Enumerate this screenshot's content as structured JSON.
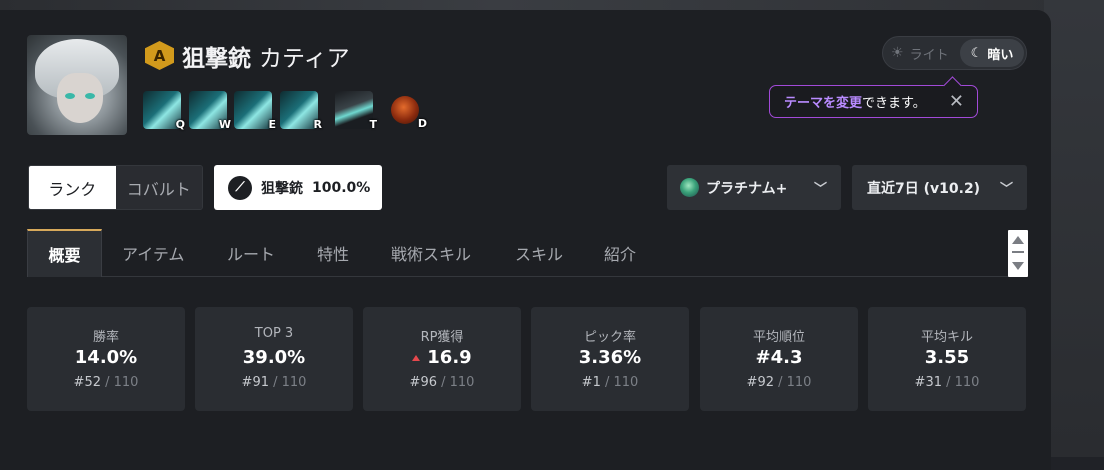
{
  "character": {
    "tier": "A",
    "weapon": "狙撃銃",
    "name": "カティア",
    "skills": [
      {
        "key": "Q",
        "icon": "skill-q-icon"
      },
      {
        "key": "W",
        "icon": "skill-w-icon"
      },
      {
        "key": "E",
        "icon": "skill-e-icon"
      },
      {
        "key": "R",
        "icon": "skill-r-icon"
      },
      {
        "key": "T",
        "icon": "skill-t-icon"
      },
      {
        "key": "D",
        "icon": "skill-d-icon"
      }
    ]
  },
  "theme": {
    "light_label": "ライト",
    "dark_label": "暗い",
    "selected": "dark"
  },
  "tooltip": {
    "highlight": "テーマを変更",
    "rest": "できます。",
    "close": "✕"
  },
  "filters": {
    "mode_options": [
      "ランク",
      "コバルト"
    ],
    "mode_selected": "ランク",
    "weapon_label": "狙撃銃",
    "weapon_pct": "100.0%",
    "tier_label": "プラチナム+",
    "period_label": "直近7日 (v10.2)"
  },
  "tabs": [
    "概要",
    "アイテム",
    "ルート",
    "特性",
    "戦術スキル",
    "スキル",
    "紹介"
  ],
  "stats": [
    {
      "label": "勝率",
      "value": "14.0%",
      "rank": "#52",
      "total": " / 110",
      "trend": ""
    },
    {
      "label": "TOP 3",
      "value": "39.0%",
      "rank": "#91",
      "total": " / 110",
      "trend": ""
    },
    {
      "label": "RP獲得",
      "value": "16.9",
      "rank": "#96",
      "total": " / 110",
      "trend": "up"
    },
    {
      "label": "ピック率",
      "value": "3.36%",
      "rank": "#1",
      "total": " / 110",
      "trend": ""
    },
    {
      "label": "平均順位",
      "value": "#4.3",
      "rank": "#92",
      "total": " / 110",
      "trend": ""
    },
    {
      "label": "平均キル",
      "value": "3.55",
      "rank": "#31",
      "total": " / 110",
      "trend": ""
    }
  ],
  "colors": {
    "accent_purple": "#a24ad8",
    "tab_active_border": "#d7a95b",
    "tier_badge": "#d29a1c",
    "trend_up": "#e5484d"
  }
}
